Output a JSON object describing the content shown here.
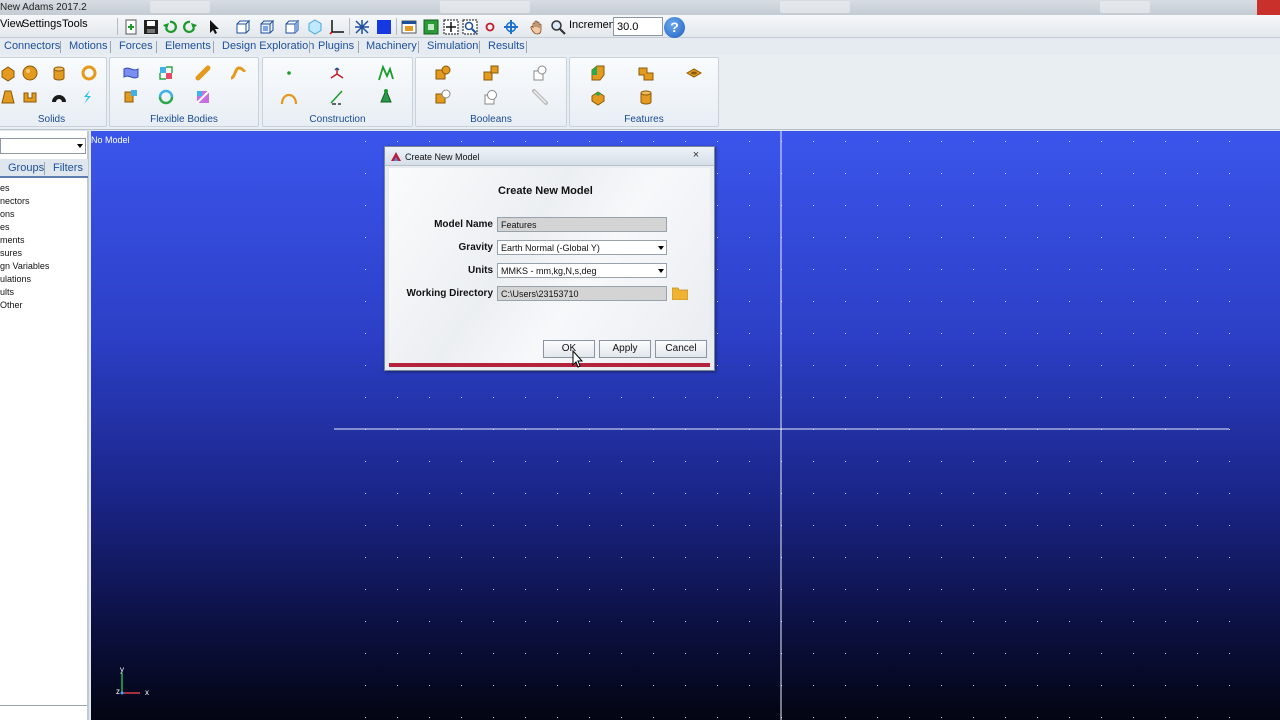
{
  "window": {
    "title": "New Adams 2017.2"
  },
  "menubar": {
    "items": [
      "View",
      "Settings",
      "Tools"
    ]
  },
  "toolbar": {
    "increment_label": "Increment",
    "increment_value": "30.0",
    "help_label": "?"
  },
  "ribbon": {
    "tabs": [
      "Connectors",
      "Motions",
      "Forces",
      "Elements",
      "Design Exploration",
      "Plugins",
      "Machinery",
      "Simulation",
      "Results"
    ],
    "panels": [
      "Solids",
      "Flexible Bodies",
      "Construction",
      "Booleans",
      "Features"
    ]
  },
  "browser": {
    "tabs": [
      "Groups",
      "Filters"
    ],
    "items": [
      "es",
      "nectors",
      "ons",
      "es",
      "ments",
      "sures",
      "gn Variables",
      "ulations",
      "ults",
      "Other"
    ]
  },
  "viewport": {
    "status_text": "No Model",
    "triad": {
      "y_label": "y",
      "z_label": "z",
      "x_label": "x"
    }
  },
  "dialog": {
    "window_title": "Create New Model",
    "close_glyph": "×",
    "heading": "Create New Model",
    "fields": {
      "model_name": {
        "label": "Model Name",
        "value": "Features"
      },
      "gravity": {
        "label": "Gravity",
        "value": "Earth Normal (-Global Y)"
      },
      "units": {
        "label": "Units",
        "value": "MMKS - mm,kg,N,s,deg"
      },
      "working_directory": {
        "label": "Working Directory",
        "value": "C:\\Users\\23153710"
      }
    },
    "buttons": {
      "ok": "OK",
      "apply": "Apply",
      "cancel": "Cancel"
    }
  },
  "colors": {
    "viewport_top": "#3b55ec",
    "viewport_bottom": "#030512",
    "ribbon_text": "#1d4f9a",
    "dialog_accent": "#b3243c",
    "icon_orange": "#e39a1e"
  },
  "icons": {
    "toolbar": [
      "new-model-icon",
      "save-icon",
      "undo-icon",
      "redo-icon",
      "select-arrow-icon",
      "view-front-icon",
      "view-top-icon",
      "view-right-icon",
      "view-iso-icon",
      "triad-icon",
      "toggle-icon",
      "render-solid-icon",
      "window-icon",
      "fit-icon",
      "zoom-box-icon",
      "center-icon",
      "rotate-icon",
      "pan-hand-icon",
      "zoom-icon"
    ],
    "solids": [
      "box-icon",
      "sphere-icon",
      "cylinder-icon",
      "torus-icon",
      "frustum-icon",
      "link-icon",
      "arc-icon",
      "plate-icon"
    ],
    "flexible_bodies": [
      "flex-icon-1",
      "flex-icon-2",
      "flex-icon-3",
      "flex-icon-4",
      "flex-icon-5",
      "flex-icon-6",
      "flex-icon-7"
    ],
    "construction": [
      "point-icon",
      "marker-icon",
      "polyline-icon",
      "arc-construct-icon",
      "coordinate-icon",
      "solid-spline-icon"
    ],
    "booleans": [
      "union-icon",
      "merge-icon",
      "intersect-icon",
      "cut-icon",
      "split-icon",
      "chain-icon"
    ],
    "features": [
      "chamfer-icon",
      "hole-icon",
      "boss-icon",
      "fillet-icon",
      "hollow-icon"
    ]
  }
}
